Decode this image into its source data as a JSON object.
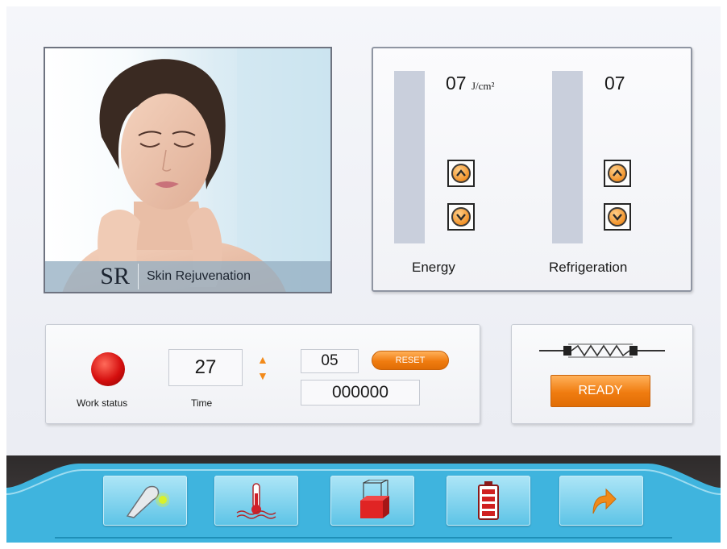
{
  "mode": {
    "abbreviation": "SR",
    "name": "Skin Rejuvenation"
  },
  "energy": {
    "value": "07",
    "unit": "J/cm²",
    "label": "Energy"
  },
  "refrigeration": {
    "value": "07",
    "label": "Refrigeration"
  },
  "work": {
    "status_label": "Work status",
    "status_color": "#d50f0f",
    "time_value": "27",
    "time_label": "Time",
    "count_value": "05",
    "reset_label": "RESET",
    "total_counter": "000000"
  },
  "ready": {
    "button_label": "READY",
    "icon": "lamp-filament-icon"
  },
  "toolbar": {
    "items": [
      {
        "icon": "handpiece-icon"
      },
      {
        "icon": "thermometer-icon"
      },
      {
        "icon": "water-tank-icon"
      },
      {
        "icon": "battery-icon"
      },
      {
        "icon": "back-arrow-icon"
      }
    ]
  },
  "colors": {
    "accent_orange": "#f07c10",
    "toolbar_blue": "#5cc3e6",
    "level_bar": "#c9cfdc"
  }
}
